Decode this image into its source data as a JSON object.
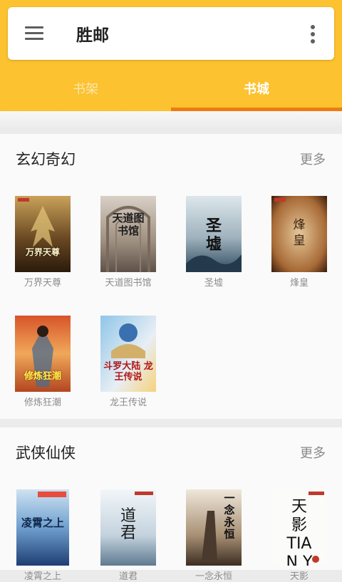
{
  "app": {
    "title": "胜邮"
  },
  "tabs": [
    {
      "label": "书架",
      "active": false
    },
    {
      "label": "书城",
      "active": true
    }
  ],
  "colors": {
    "header": "#fcc22f",
    "tab_indicator": "#ef7a12"
  },
  "sections": [
    {
      "title": "玄幻奇幻",
      "more_label": "更多",
      "books": [
        {
          "name": "万界天尊",
          "cover_text": "万界天尊"
        },
        {
          "name": "天道图书馆",
          "cover_text": "天道图书馆"
        },
        {
          "name": "圣墟",
          "cover_text": "圣墟"
        },
        {
          "name": "烽皇",
          "cover_text": "烽皇"
        },
        {
          "name": "修炼狂潮",
          "cover_text": "修炼狂潮"
        },
        {
          "name": "龙王传说",
          "cover_text": "斗罗大陆 龙王传说"
        }
      ]
    },
    {
      "title": "武侠仙侠",
      "more_label": "更多",
      "books": [
        {
          "name": "凌霄之上",
          "cover_text": "凌霄之上"
        },
        {
          "name": "道君",
          "cover_text": "道君"
        },
        {
          "name": "一念永恒",
          "cover_text": "一念永恒"
        },
        {
          "name": "天影",
          "cover_text": "天影 TIAN YING"
        }
      ]
    }
  ]
}
